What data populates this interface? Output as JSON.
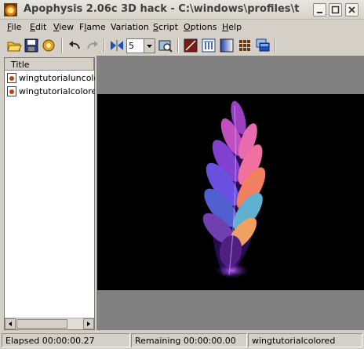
{
  "window": {
    "title": "Apophysis 2.06c 3D hack - C:\\windows\\profiles\\t"
  },
  "menu": [
    {
      "label_pre": "",
      "label_u": "F",
      "label_post": "ile"
    },
    {
      "label_pre": "",
      "label_u": "E",
      "label_post": "dit"
    },
    {
      "label_pre": "",
      "label_u": "V",
      "label_post": "iew"
    },
    {
      "label_pre": "F",
      "label_u": "l",
      "label_post": "ame"
    },
    {
      "label_pre": "Variation",
      "label_u": "",
      "label_post": ""
    },
    {
      "label_pre": "",
      "label_u": "S",
      "label_post": "cript"
    },
    {
      "label_pre": "",
      "label_u": "O",
      "label_post": "ptions"
    },
    {
      "label_pre": "",
      "label_u": "H",
      "label_post": "elp"
    }
  ],
  "toolbar": {
    "icons": [
      "open-icon",
      "save-icon",
      "randomize-icon",
      "undo-icon",
      "redo-icon",
      "mutate-icon",
      "preview-icon",
      "adjust-icon",
      "editor-icon",
      "gradient-icon",
      "random-batch-icon",
      "explorer-icon"
    ],
    "spin_value": "5"
  },
  "list": {
    "header": "Title",
    "items": [
      "wingtutorialuncolored",
      "wingtutorialcolored"
    ]
  },
  "status": {
    "elapsed": "Elapsed 00:00:00.27",
    "remaining": "Remaining 00:00:00.00",
    "name": "wingtutorialcolored"
  },
  "colors": {
    "face": "#d4d0c8",
    "render_bg": "#000000",
    "canvas_bg": "#808080"
  }
}
